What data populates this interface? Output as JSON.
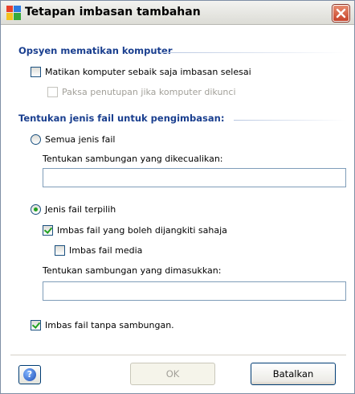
{
  "window": {
    "title": "Tetapan imbasan tambahan"
  },
  "shutdown_section": {
    "title": "Opsyen mematikan komputer",
    "shutdown_checkbox_label": "Matikan komputer sebaik saja imbasan selesai",
    "shutdown_checked": false,
    "force_checkbox_label": "Paksa penutupan jika komputer dikunci",
    "force_checked": false,
    "force_disabled": true
  },
  "file_types_section": {
    "title": "Tentukan jenis fail untuk pengimbasan:",
    "all_types_label": "Semua jenis fail",
    "all_types_selected": false,
    "excluded_ext_label": "Tentukan sambungan yang dikecualikan:",
    "excluded_ext_value": "",
    "selected_types_label": "Jenis fail terpilih",
    "selected_types_selected": true,
    "infectable_only_label": "Imbas fail yang boleh dijangkiti sahaja",
    "infectable_only_checked": true,
    "media_files_label": "Imbas fail media",
    "media_files_checked": false,
    "included_ext_label": "Tentukan sambungan yang dimasukkan:",
    "included_ext_value": "",
    "no_extension_label": "Imbas fail tanpa sambungan.",
    "no_extension_checked": true
  },
  "buttons": {
    "help_icon_glyph": "?",
    "ok_label": "OK",
    "ok_disabled": true,
    "cancel_label": "Batalkan"
  }
}
